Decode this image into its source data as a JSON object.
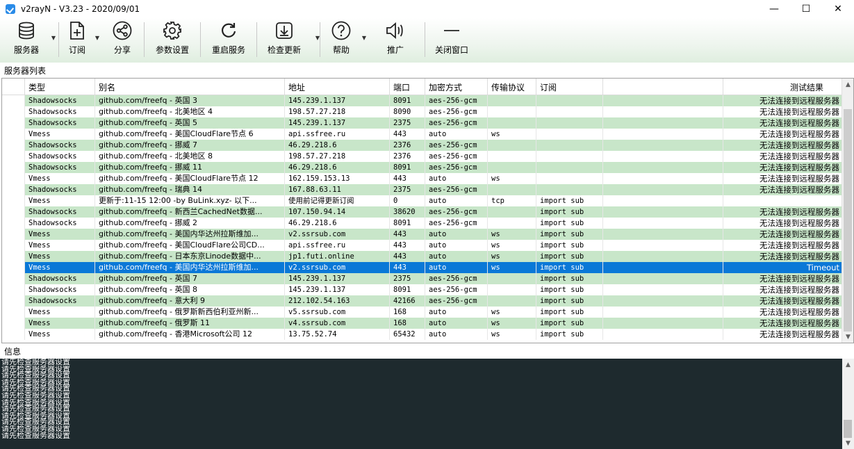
{
  "window": {
    "title": "v2rayN - V3.23 - 2020/09/01",
    "minimize": "—",
    "maximize": "☐",
    "close": "✕"
  },
  "toolbar": {
    "items": [
      {
        "label": "服务器",
        "icon": "database-icon",
        "dropdown": true
      },
      {
        "label": "订阅",
        "icon": "add-file-icon",
        "dropdown": true
      },
      {
        "label": "分享",
        "icon": "share-icon",
        "dropdown": false
      },
      {
        "label": "参数设置",
        "icon": "gear-icon",
        "dropdown": false
      },
      {
        "label": "重启服务",
        "icon": "restart-icon",
        "dropdown": false
      },
      {
        "label": "检查更新",
        "icon": "download-icon",
        "dropdown": true
      },
      {
        "label": "帮助",
        "icon": "help-icon",
        "dropdown": true
      },
      {
        "label": "推广",
        "icon": "speaker-icon",
        "dropdown": false
      },
      {
        "label": "关闭窗口",
        "icon": "minus-icon",
        "dropdown": false
      }
    ]
  },
  "server_list": {
    "label": "服务器列表",
    "columns": [
      "",
      "类型",
      "别名",
      "地址",
      "端口",
      "加密方式",
      "传输协议",
      "订阅",
      "",
      "测试结果"
    ],
    "rows": [
      {
        "type": "Shadowsocks",
        "alias": "github.com/freefq - 英国  3",
        "address": "145.239.1.137",
        "port": "8091",
        "security": "aes-256-gcm",
        "network": "",
        "sub": "",
        "result": "无法连接到远程服务器",
        "style": "green"
      },
      {
        "type": "Shadowsocks",
        "alias": "github.com/freefq - 北美地区  4",
        "address": "198.57.27.218",
        "port": "8090",
        "security": "aes-256-gcm",
        "network": "",
        "sub": "",
        "result": "无法连接到远程服务器",
        "style": "white"
      },
      {
        "type": "Shadowsocks",
        "alias": "github.com/freefq - 英国  5",
        "address": "145.239.1.137",
        "port": "2375",
        "security": "aes-256-gcm",
        "network": "",
        "sub": "",
        "result": "无法连接到远程服务器",
        "style": "green"
      },
      {
        "type": "Vmess",
        "alias": "github.com/freefq - 美国CloudFlare节点 6",
        "address": "api.ssfree.ru",
        "port": "443",
        "security": "auto",
        "network": "ws",
        "sub": "",
        "result": "无法连接到远程服务器",
        "style": "white"
      },
      {
        "type": "Shadowsocks",
        "alias": "github.com/freefq - 挪威  7",
        "address": "46.29.218.6",
        "port": "2376",
        "security": "aes-256-gcm",
        "network": "",
        "sub": "",
        "result": "无法连接到远程服务器",
        "style": "green"
      },
      {
        "type": "Shadowsocks",
        "alias": "github.com/freefq - 北美地区  8",
        "address": "198.57.27.218",
        "port": "2376",
        "security": "aes-256-gcm",
        "network": "",
        "sub": "",
        "result": "无法连接到远程服务器",
        "style": "white"
      },
      {
        "type": "Shadowsocks",
        "alias": "github.com/freefq - 挪威  11",
        "address": "46.29.218.6",
        "port": "8091",
        "security": "aes-256-gcm",
        "network": "",
        "sub": "",
        "result": "无法连接到远程服务器",
        "style": "green"
      },
      {
        "type": "Vmess",
        "alias": "github.com/freefq - 美国CloudFlare节点 12",
        "address": "162.159.153.13",
        "port": "443",
        "security": "auto",
        "network": "ws",
        "sub": "",
        "result": "无法连接到远程服务器",
        "style": "white"
      },
      {
        "type": "Shadowsocks",
        "alias": "github.com/freefq - 瑞典  14",
        "address": "167.88.63.11",
        "port": "2375",
        "security": "aes-256-gcm",
        "network": "",
        "sub": "",
        "result": "无法连接到远程服务器",
        "style": "green"
      },
      {
        "type": "Vmess",
        "alias": "更新于:11-15 12:00 -by BuLink.xyz- 以下...",
        "address": "使用前记得更新订阅",
        "port": "0",
        "security": "auto",
        "network": "tcp",
        "sub": "import sub",
        "result": "",
        "style": "white"
      },
      {
        "type": "Shadowsocks",
        "alias": "github.com/freefq - 新西兰CachedNet数据...",
        "address": "107.150.94.14",
        "port": "38620",
        "security": "aes-256-gcm",
        "network": "",
        "sub": "import sub",
        "result": "无法连接到远程服务器",
        "style": "green"
      },
      {
        "type": "Shadowsocks",
        "alias": "github.com/freefq - 挪威  2",
        "address": "46.29.218.6",
        "port": "8091",
        "security": "aes-256-gcm",
        "network": "",
        "sub": "import sub",
        "result": "无法连接到远程服务器",
        "style": "white"
      },
      {
        "type": "Vmess",
        "alias": "github.com/freefq - 美国内华达州拉斯维加...",
        "address": "v2.ssrsub.com",
        "port": "443",
        "security": "auto",
        "network": "ws",
        "sub": "import sub",
        "result": "无法连接到远程服务器",
        "style": "green"
      },
      {
        "type": "Vmess",
        "alias": "github.com/freefq - 美国CloudFlare公司CD...",
        "address": "api.ssfree.ru",
        "port": "443",
        "security": "auto",
        "network": "ws",
        "sub": "import sub",
        "result": "无法连接到远程服务器",
        "style": "white"
      },
      {
        "type": "Vmess",
        "alias": "github.com/freefq - 日本东京Linode数据中...",
        "address": "jp1.futi.online",
        "port": "443",
        "security": "auto",
        "network": "ws",
        "sub": "import sub",
        "result": "无法连接到远程服务器",
        "style": "green"
      },
      {
        "type": "Vmess",
        "alias": "github.com/freefq - 美国内华达州拉斯维加...",
        "address": "v2.ssrsub.com",
        "port": "443",
        "security": "auto",
        "network": "ws",
        "sub": "import sub",
        "result": "Timeout",
        "style": "selected"
      },
      {
        "type": "Shadowsocks",
        "alias": "github.com/freefq - 英国  7",
        "address": "145.239.1.137",
        "port": "2375",
        "security": "aes-256-gcm",
        "network": "",
        "sub": "import sub",
        "result": "无法连接到远程服务器",
        "style": "green"
      },
      {
        "type": "Shadowsocks",
        "alias": "github.com/freefq - 英国  8",
        "address": "145.239.1.137",
        "port": "8091",
        "security": "aes-256-gcm",
        "network": "",
        "sub": "import sub",
        "result": "无法连接到远程服务器",
        "style": "white"
      },
      {
        "type": "Shadowsocks",
        "alias": "github.com/freefq - 意大利  9",
        "address": "212.102.54.163",
        "port": "42166",
        "security": "aes-256-gcm",
        "network": "",
        "sub": "import sub",
        "result": "无法连接到远程服务器",
        "style": "green"
      },
      {
        "type": "Vmess",
        "alias": "github.com/freefq - 俄罗斯新西伯利亚州新...",
        "address": "v5.ssrsub.com",
        "port": "168",
        "security": "auto",
        "network": "ws",
        "sub": "import sub",
        "result": "无法连接到远程服务器",
        "style": "white"
      },
      {
        "type": "Vmess",
        "alias": "github.com/freefq - 俄罗斯  11",
        "address": "v4.ssrsub.com",
        "port": "168",
        "security": "auto",
        "network": "ws",
        "sub": "import sub",
        "result": "无法连接到远程服务器",
        "style": "green"
      },
      {
        "type": "Vmess",
        "alias": "github.com/freefq - 香港Microsoft公司 12",
        "address": "13.75.52.74",
        "port": "65432",
        "security": "auto",
        "network": "ws",
        "sub": "import sub",
        "result": "无法连接到远程服务器",
        "style": "white"
      }
    ]
  },
  "info": {
    "label": "信息",
    "lines": [
      "请先检查服务器设置",
      "请先检查服务器设置",
      "请先检查服务器设置",
      "请先检查服务器设置",
      "请先检查服务器设置",
      "请先检查服务器设置",
      "请先检查服务器设置",
      "请先检查服务器设置",
      "请先检查服务器设置",
      "请先检查服务器设置",
      "请先检查服务器设置",
      "请先检查服务器设置"
    ]
  }
}
